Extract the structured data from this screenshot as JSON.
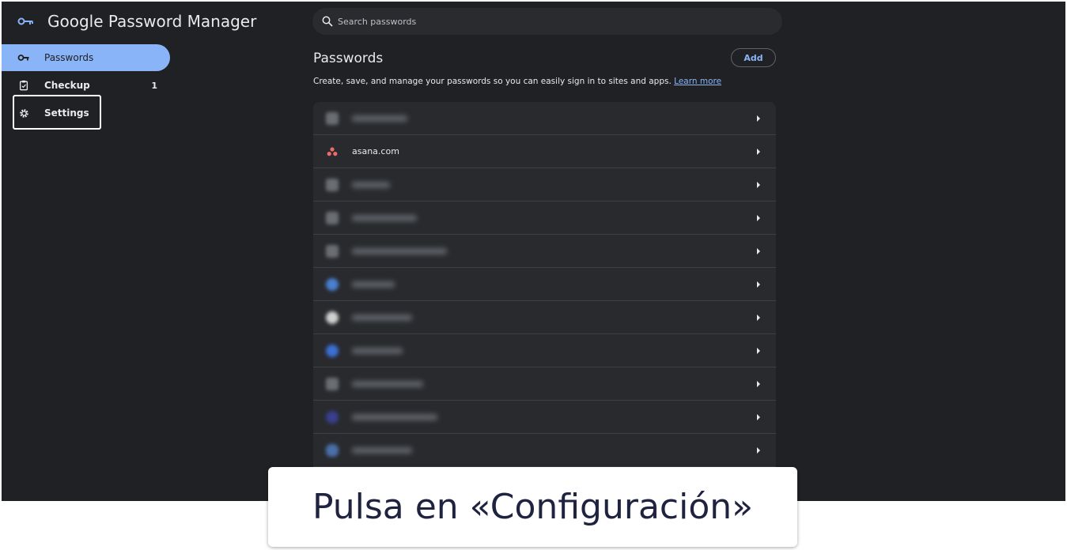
{
  "header": {
    "title": "Google Password Manager",
    "logo_icon": "key-icon"
  },
  "search": {
    "placeholder": "Search passwords",
    "icon": "search-icon"
  },
  "sidebar": {
    "items": [
      {
        "label": "Passwords",
        "icon": "key-icon",
        "active": true
      },
      {
        "label": "Checkup",
        "icon": "clipboard-check-icon",
        "badge": "1"
      },
      {
        "label": "Settings",
        "icon": "gear-icon",
        "highlighted": true
      }
    ]
  },
  "main": {
    "title": "Passwords",
    "add_label": "Add",
    "description": "Create, save, and manage your passwords so you can easily sign in to sites and apps.",
    "learn_more": "Learn more",
    "rows": [
      {
        "site": "",
        "blurred": true
      },
      {
        "site": "asana.com",
        "blurred": false
      },
      {
        "site": "",
        "blurred": true
      },
      {
        "site": "",
        "blurred": true
      },
      {
        "site": "",
        "blurred": true
      },
      {
        "site": "",
        "blurred": true
      },
      {
        "site": "",
        "blurred": true
      },
      {
        "site": "",
        "blurred": true
      },
      {
        "site": "",
        "blurred": true
      },
      {
        "site": "",
        "blurred": true
      },
      {
        "site": "",
        "blurred": true
      }
    ]
  },
  "caption": {
    "text": "Pulsa en «Configuración»"
  },
  "colors": {
    "background": "#202124",
    "accent": "#8ab4f8",
    "asana": "#f06a6a"
  }
}
